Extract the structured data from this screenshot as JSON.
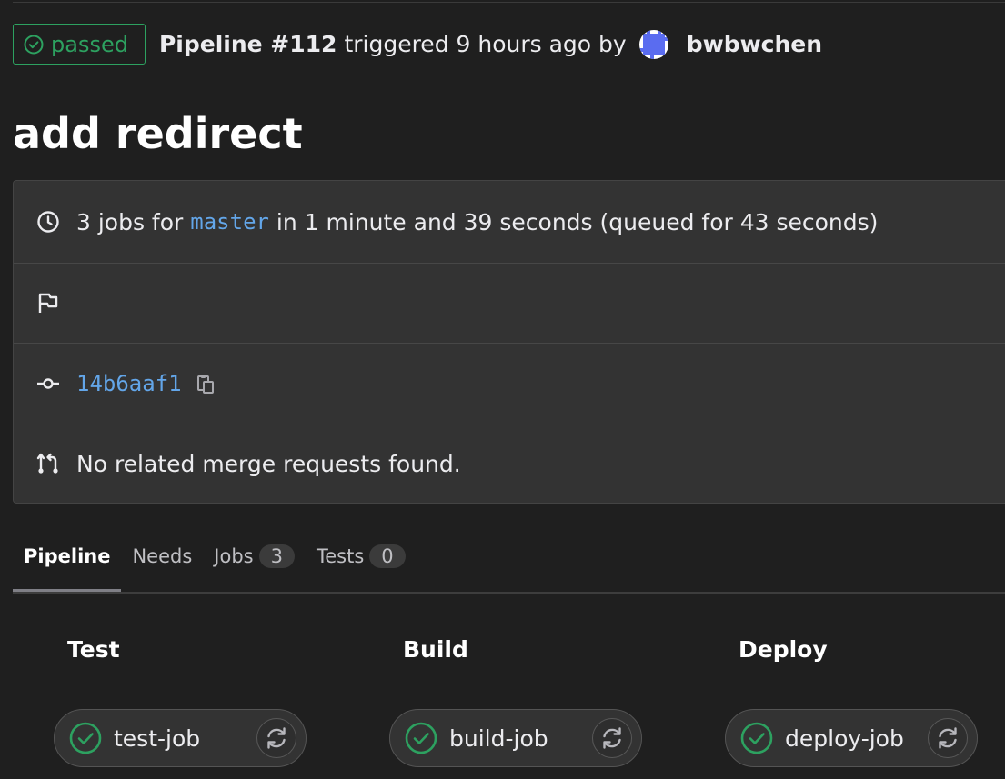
{
  "header": {
    "status": "passed",
    "pipeline_id": "Pipeline #112",
    "triggered": "triggered 9 hours ago by",
    "author": "bwbwchen"
  },
  "commit_title": "add redirect",
  "info": {
    "jobs_text": "3 jobs for",
    "branch": "master",
    "duration_text": "in 1 minute and 39 seconds (queued for 43 seconds)",
    "commit_sha": "14b6aaf1",
    "merge_requests": "No related merge requests found."
  },
  "tabs": [
    {
      "label": "Pipeline"
    },
    {
      "label": "Needs"
    },
    {
      "label": "Jobs",
      "count": "3"
    },
    {
      "label": "Tests",
      "count": "0"
    }
  ],
  "stages": [
    {
      "title": "Test",
      "job": "test-job"
    },
    {
      "title": "Build",
      "job": "build-job"
    },
    {
      "title": "Deploy",
      "job": "deploy-job"
    }
  ],
  "colors": {
    "success": "#2da160",
    "link": "#63a6e9",
    "background": "#1f1f1f",
    "panel": "#333333"
  },
  "icons": {
    "status": "check-circle-icon",
    "clock": "clock-icon",
    "flag": "flag-icon",
    "commit": "commit-icon",
    "copy": "clipboard-icon",
    "merge_request": "merge-request-icon",
    "retry": "retry-icon"
  }
}
